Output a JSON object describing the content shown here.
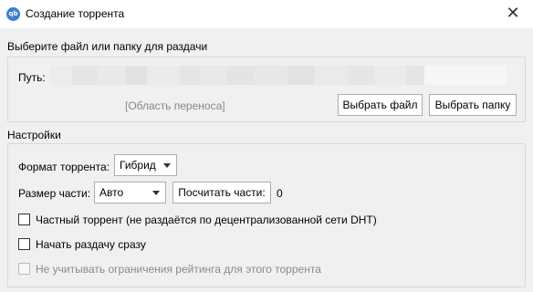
{
  "window": {
    "title": "Создание торрента",
    "app_icon_text": "qb",
    "close_glyph": "✕"
  },
  "source": {
    "section_label": "Выберите файл или папку для раздачи",
    "path_label": "Путь:",
    "path_value": "",
    "drop_area_label": "[Область переноса]",
    "select_file_button": "Выбрать файл",
    "select_folder_button": "Выбрать папку"
  },
  "settings": {
    "section_label": "Настройки",
    "format_label": "Формат торрента:",
    "format_value": "Гибрид",
    "piece_size_label": "Размер части:",
    "piece_size_value": "Авто",
    "calc_pieces_button": "Посчитать части:",
    "pieces_count": "0",
    "checkboxes": [
      {
        "label": "Частный торрент (не раздаётся по децентрализованной сети DHT)",
        "checked": false,
        "enabled": true
      },
      {
        "label": "Начать раздачу сразу",
        "checked": false,
        "enabled": true
      },
      {
        "label": "Не учитывать ограничения рейтинга для этого торрента",
        "checked": false,
        "enabled": false
      }
    ]
  },
  "colors": {
    "background": "#f0f0f0",
    "icon_blue": "#3c7fd0",
    "disabled_text": "#8a8a8a"
  }
}
